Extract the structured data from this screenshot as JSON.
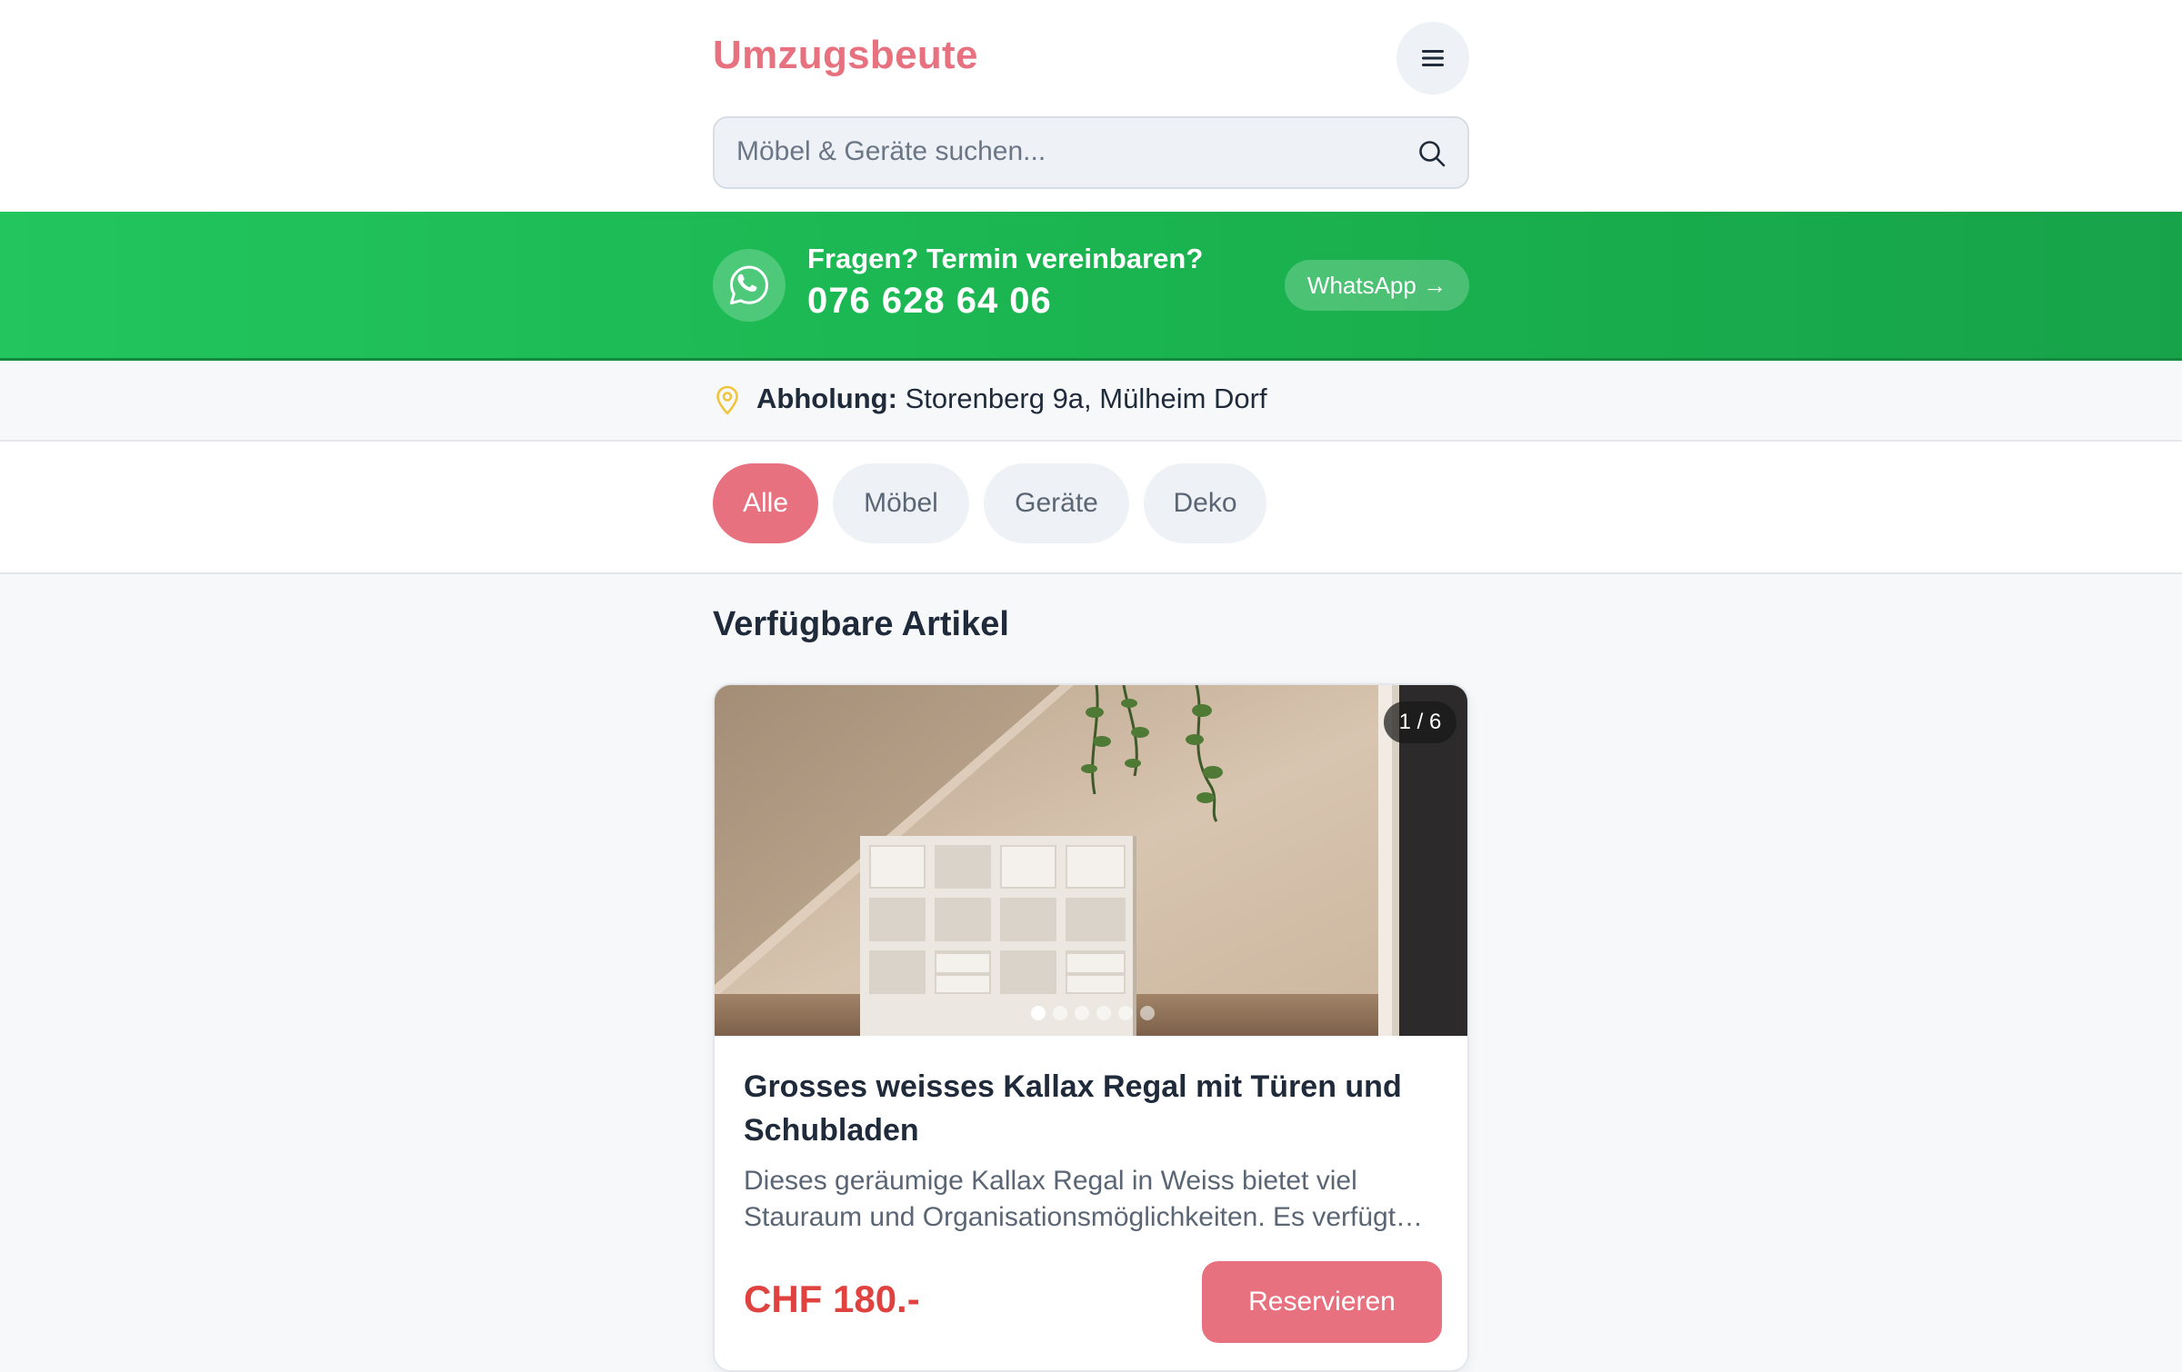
{
  "header": {
    "logo": "Umzugsbeute",
    "menu_icon": "hamburger-menu-icon"
  },
  "search": {
    "placeholder": "Möbel & Geräte suchen...",
    "icon": "search-icon"
  },
  "banner": {
    "question": "Fragen? Termin vereinbaren?",
    "phone": "076 628 64 06",
    "button_label": "WhatsApp →",
    "icon": "whatsapp-icon",
    "color": "#22c55e"
  },
  "pickup": {
    "label": "Abholung:",
    "address": "Storenberg 9a, Mülheim Dorf",
    "icon": "location-pin-icon"
  },
  "filters": [
    {
      "label": "Alle",
      "active": true
    },
    {
      "label": "Möbel",
      "active": false
    },
    {
      "label": "Geräte",
      "active": false
    },
    {
      "label": "Deko",
      "active": false
    }
  ],
  "section_title": "Verfügbare Artikel",
  "items": [
    {
      "image_counter": "1 / 6",
      "image_index": 1,
      "image_total": 6,
      "title": "Grosses weisses Kallax Regal mit Türen und Schubladen",
      "description": "Dieses geräumige Kallax Regal in Weiss bietet viel Stauraum und Organisationsmöglichkeiten. Es verfügt über Türen und Schubladen.",
      "price": "CHF 180.-",
      "button_label": "Reservieren"
    }
  ],
  "colors": {
    "accent": "#e8717f",
    "price": "#e0433f",
    "whatsapp_green": "#22c55e"
  }
}
